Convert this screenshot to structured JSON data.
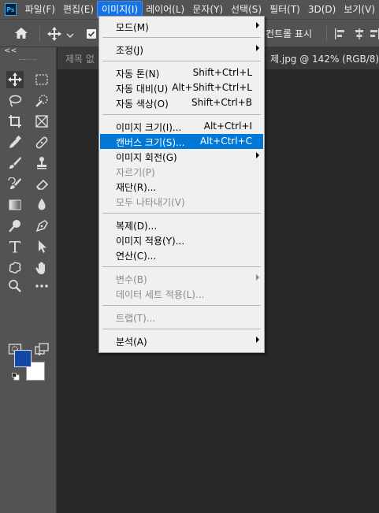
{
  "app": {
    "logo": "Ps"
  },
  "menubar": {
    "items": [
      {
        "label": "파일(F)"
      },
      {
        "label": "편집(E)"
      },
      {
        "label": "이미지(I)"
      },
      {
        "label": "레이어(L)"
      },
      {
        "label": "문자(Y)"
      },
      {
        "label": "선택(S)"
      },
      {
        "label": "필터(T)"
      },
      {
        "label": "3D(D)"
      },
      {
        "label": "보기(V)"
      }
    ]
  },
  "options_bar": {
    "label_fragment": "컨트롤 표시"
  },
  "tools_panel": {
    "collapse_glyph": "<<"
  },
  "document_tab": {
    "left_fragment": "제목 없",
    "right_fragment": "제.jpg @ 142% (RGB/8) *"
  },
  "colors": {
    "foreground": "#1448a8",
    "background": "#ffffff",
    "highlight": "#0078d7"
  },
  "image_menu": {
    "items": [
      {
        "label": "모드(M)",
        "shortcut": "",
        "submenu": true,
        "disabled": false,
        "highlighted": false
      },
      {
        "label": "조정(J)",
        "shortcut": "",
        "submenu": true,
        "disabled": false,
        "highlighted": false
      },
      {
        "label": "자동 톤(N)",
        "shortcut": "Shift+Ctrl+L",
        "submenu": false,
        "disabled": false,
        "highlighted": false
      },
      {
        "label": "자동 대비(U)",
        "shortcut": "Alt+Shift+Ctrl+L",
        "submenu": false,
        "disabled": false,
        "highlighted": false
      },
      {
        "label": "자동 색상(O)",
        "shortcut": "Shift+Ctrl+B",
        "submenu": false,
        "disabled": false,
        "highlighted": false
      },
      {
        "label": "이미지 크기(I)...",
        "shortcut": "Alt+Ctrl+I",
        "submenu": false,
        "disabled": false,
        "highlighted": false
      },
      {
        "label": "캔버스 크기(S)...",
        "shortcut": "Alt+Ctrl+C",
        "submenu": false,
        "disabled": false,
        "highlighted": true
      },
      {
        "label": "이미지 회전(G)",
        "shortcut": "",
        "submenu": true,
        "disabled": false,
        "highlighted": false
      },
      {
        "label": "자르기(P)",
        "shortcut": "",
        "submenu": false,
        "disabled": true,
        "highlighted": false
      },
      {
        "label": "재단(R)...",
        "shortcut": "",
        "submenu": false,
        "disabled": false,
        "highlighted": false
      },
      {
        "label": "모두 나타내기(V)",
        "shortcut": "",
        "submenu": false,
        "disabled": true,
        "highlighted": false
      },
      {
        "label": "복제(D)...",
        "shortcut": "",
        "submenu": false,
        "disabled": false,
        "highlighted": false
      },
      {
        "label": "이미지 적용(Y)...",
        "shortcut": "",
        "submenu": false,
        "disabled": false,
        "highlighted": false
      },
      {
        "label": "연산(C)...",
        "shortcut": "",
        "submenu": false,
        "disabled": false,
        "highlighted": false
      },
      {
        "label": "변수(B)",
        "shortcut": "",
        "submenu": true,
        "disabled": true,
        "highlighted": false
      },
      {
        "label": "데이터 세트 적용(L)...",
        "shortcut": "",
        "submenu": false,
        "disabled": true,
        "highlighted": false
      },
      {
        "label": "트랩(T)...",
        "shortcut": "",
        "submenu": false,
        "disabled": true,
        "highlighted": false
      },
      {
        "label": "분석(A)",
        "shortcut": "",
        "submenu": true,
        "disabled": false,
        "highlighted": false
      }
    ]
  }
}
